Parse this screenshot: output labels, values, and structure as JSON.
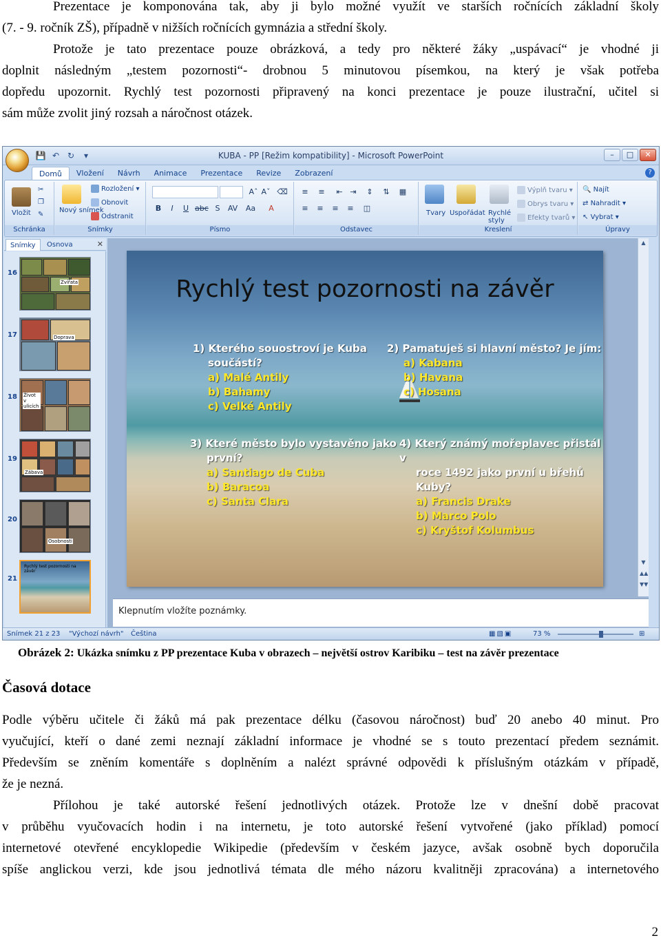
{
  "intro": {
    "lines": [
      "Prezentace je komponována tak, aby ji bylo možné využít ve starších ročnících základní školy",
      "(7. - 9. ročník ZŠ), případně v nižších ročnících gymnázia a střední školy.",
      "Protože je tato prezentace pouze obrázková, a tedy pro některé žáky „uspávací“ je vhodné ji",
      "doplnit následným „testem pozornosti“- drobnou 5 minutovou písemkou, na který je však potřeba",
      "dopředu upozornit. Rychlý test pozornosti připravený na konci prezentace je pouze ilustrační, učitel si",
      "sám může zvolit jiný rozsah a náročnost otázek."
    ]
  },
  "ppt": {
    "window_title": "KUBA - PP [Režim kompatibility] - Microsoft PowerPoint",
    "tabs": [
      "Domů",
      "Vložení",
      "Návrh",
      "Animace",
      "Prezentace",
      "Revize",
      "Zobrazení"
    ],
    "ribbon": {
      "groups": [
        "Schránka",
        "Snímky",
        "Písmo",
        "Odstavec",
        "Kreslení",
        "Úpravy"
      ],
      "paste": "Vložit",
      "new_slide": "Nový snímek",
      "layout": "Rozložení",
      "reset": "Obnovit",
      "delete": "Odstranit",
      "shapes": "Tvary",
      "arrange": "Uspořádat",
      "quick_styles": "Rychlé styly",
      "fill": "Výplň tvaru",
      "outline": "Obrys tvaru",
      "effects": "Efekty tvarů",
      "find": "Najít",
      "replace": "Nahradit",
      "select": "Vybrat"
    },
    "pane_tabs": [
      "Snímky",
      "Osnova"
    ],
    "slide_numbers": [
      "16",
      "17",
      "18",
      "19",
      "20",
      "21"
    ],
    "thumb_labels": {
      "t16": "Zvířata",
      "t17": "Doprava",
      "t18": "Život v ulicích",
      "t19": "Zábava",
      "t20": "Osobnosti",
      "t21": "Rychlý test pozornosti na závěr"
    },
    "slide": {
      "title": "Rychlý test pozornosti na závěr",
      "q1": {
        "q_line1": "1) Kterého souostroví je Kuba",
        "q_line2": "součástí?",
        "answers": [
          "a) Malé Antily",
          "b) Bahamy",
          "c) Velké Antily"
        ]
      },
      "q2": {
        "q_line1": "2) Pamatuješ si hlavní město? Je jím:",
        "answers": [
          "a) Kabana",
          "b) Havana",
          "c) Hosana"
        ]
      },
      "q3": {
        "q_line1": "3) Které město bylo vystavěno jako",
        "q_line2": "první?",
        "answers": [
          "a) Santiago de Cuba",
          "b) Baracoa",
          "c) Santa Clara"
        ]
      },
      "q4": {
        "q_line1": "4) Který známý mořeplavec přistál v",
        "q_line2": "roce 1492 jako první u břehů",
        "q_line3": "Kuby?",
        "answers": [
          "a) Francis Drake",
          "b) Marco Polo",
          "c) Kryštof Kolumbus"
        ]
      }
    },
    "notes_placeholder": "Klepnutím vložíte poznámky.",
    "status": {
      "slide_info": "Snímek 21 z 23",
      "theme": "\"Výchozí návrh\"",
      "language": "Čeština",
      "zoom": "73 %"
    }
  },
  "caption": {
    "label": "Obrázek 2:",
    "text": "Ukázka snímku z PP prezentace Kuba v obrazech – největší ostrov Karibiku – test na závěr prezentace"
  },
  "section": {
    "heading": "Časová dotace",
    "lines": [
      "Podle výběru učitele či žáků má pak prezentace délku (časovou náročnost) buď 20 anebo 40 minut. Pro",
      "vyučující, kteří o dané zemi neznají základní informace je vhodné se s touto prezentací předem seznámit.",
      "Především se zněním komentáře s doplněním a nalézt správné odpovědi k příslušným otázkám v případě,",
      "že je nezná.",
      "Přílohou je také autorské řešení jednotlivých otázek.  Protože lze v dnešní době pracovat",
      "v průběhu vyučovacích hodin i na internetu, je toto autorské řešení vytvořené (jako příklad) pomocí",
      "internetové otevřené encyklopedie Wikipedie (především v českém jazyce, avšak osobně bych doporučila",
      "spíše anglickou verzi, kde jsou jednotlivá témata dle mého názoru kvalitněji zpracována) a internetového"
    ]
  },
  "page_number": "2"
}
